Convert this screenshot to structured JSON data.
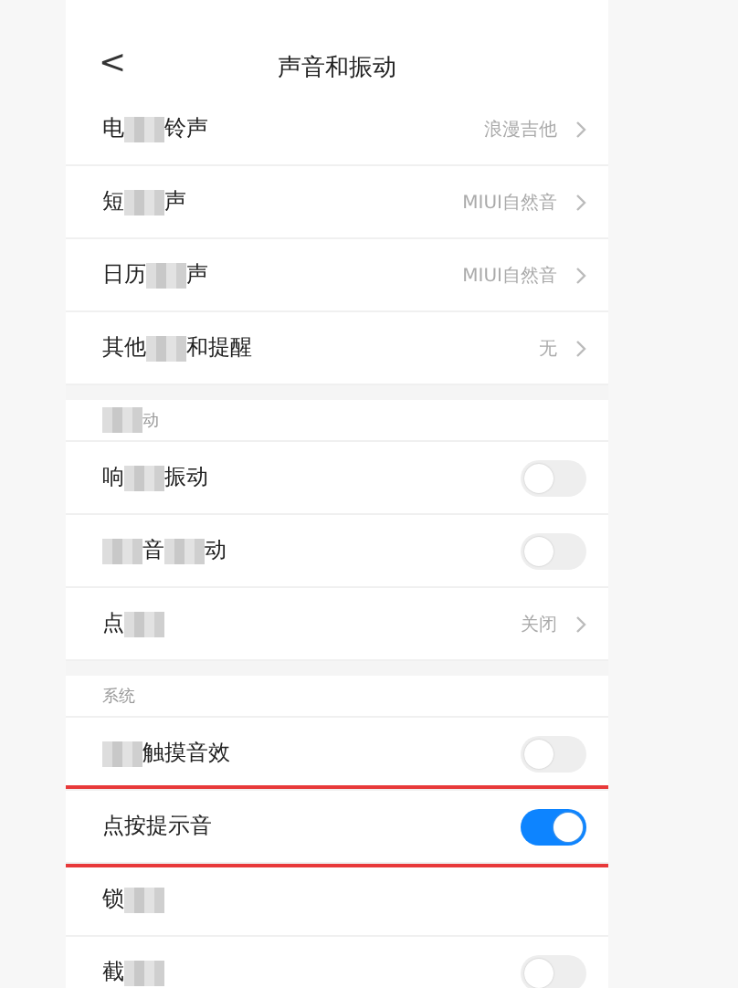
{
  "header": {
    "back": "<",
    "title": "声音和振动"
  },
  "sections": [
    {
      "rows": [
        {
          "kind": "link",
          "parts": [
            {
              "kind": "text",
              "text": "电"
            },
            {
              "kind": "mosaic"
            },
            {
              "kind": "text",
              "text": "铃声"
            }
          ],
          "value": "浪漫吉他"
        },
        {
          "kind": "link",
          "parts": [
            {
              "kind": "text",
              "text": "短"
            },
            {
              "kind": "mosaic"
            },
            {
              "kind": "text",
              "text": "声"
            }
          ],
          "value": "MIUI自然音"
        },
        {
          "kind": "link",
          "parts": [
            {
              "kind": "text",
              "text": "日历"
            },
            {
              "kind": "mosaic"
            },
            {
              "kind": "text",
              "text": "声"
            }
          ],
          "value": "MIUI自然音"
        },
        {
          "kind": "link",
          "parts": [
            {
              "kind": "text",
              "text": "其他"
            },
            {
              "kind": "mosaic"
            },
            {
              "kind": "text",
              "text": "和提醒"
            }
          ],
          "value": "无"
        }
      ]
    },
    {
      "heading": [
        {
          "kind": "mosaic"
        },
        {
          "kind": "text",
          "text": "动"
        }
      ],
      "rows": [
        {
          "kind": "toggle",
          "parts": [
            {
              "kind": "text",
              "text": "响"
            },
            {
              "kind": "mosaic"
            },
            {
              "kind": "text",
              "text": "振动"
            }
          ],
          "on": false
        },
        {
          "kind": "toggle",
          "parts": [
            {
              "kind": "mosaic"
            },
            {
              "kind": "text",
              "text": "音"
            },
            {
              "kind": "mosaic"
            },
            {
              "kind": "text",
              "text": "动"
            }
          ],
          "on": false
        },
        {
          "kind": "link",
          "parts": [
            {
              "kind": "text",
              "text": "点"
            },
            {
              "kind": "mosaic"
            }
          ],
          "value": "关闭"
        }
      ]
    },
    {
      "heading": [
        {
          "kind": "text",
          "text": "系统"
        }
      ],
      "rows": [
        {
          "kind": "toggle",
          "parts": [
            {
              "kind": "mosaic"
            },
            {
              "kind": "text",
              "text": "触摸音效"
            }
          ],
          "on": false
        },
        {
          "kind": "toggle",
          "parts": [
            {
              "kind": "text",
              "text": "点按提示音"
            }
          ],
          "on": true,
          "highlighted": true
        },
        {
          "kind": "plain",
          "parts": [
            {
              "kind": "text",
              "text": "锁"
            },
            {
              "kind": "mosaic"
            }
          ]
        },
        {
          "kind": "toggle",
          "parts": [
            {
              "kind": "text",
              "text": "截"
            },
            {
              "kind": "mosaic"
            }
          ],
          "on": false
        }
      ]
    }
  ]
}
